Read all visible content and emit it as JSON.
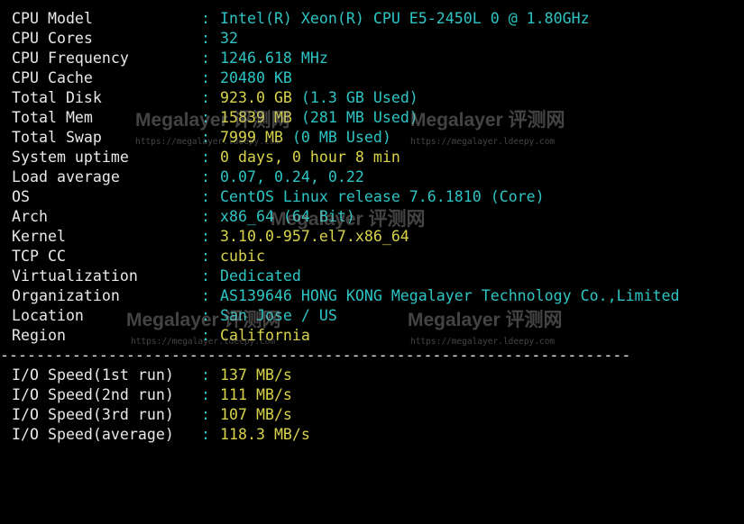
{
  "sysinfo": [
    {
      "label": "CPU Model",
      "value": "Intel(R) Xeon(R) CPU E5-2450L 0 @ 1.80GHz",
      "detail": ""
    },
    {
      "label": "CPU Cores",
      "value": "32",
      "detail": ""
    },
    {
      "label": "CPU Frequency",
      "value": "1246.618 MHz",
      "detail": ""
    },
    {
      "label": "CPU Cache",
      "value": "20480 KB",
      "detail": ""
    },
    {
      "label": "Total Disk",
      "value": "923.0 GB",
      "detail": " (1.3 GB Used)"
    },
    {
      "label": "Total Mem",
      "value": "15839 MB",
      "detail": " (281 MB Used)"
    },
    {
      "label": "Total Swap",
      "value": "7999 MB",
      "detail": " (0 MB Used)"
    },
    {
      "label": "System uptime",
      "value": "0 days, 0 hour 8 min",
      "detail": ""
    },
    {
      "label": "Load average",
      "value": "0.07, 0.24, 0.22",
      "detail": ""
    },
    {
      "label": "OS",
      "value": "CentOS Linux release 7.6.1810 (Core)",
      "detail": ""
    },
    {
      "label": "Arch",
      "value": "x86_64 (64 Bit)",
      "detail": ""
    },
    {
      "label": "Kernel",
      "value": "3.10.0-957.el7.x86_64",
      "detail": ""
    },
    {
      "label": "TCP CC",
      "value": "cubic",
      "detail": ""
    },
    {
      "label": "Virtualization",
      "value": "Dedicated",
      "detail": ""
    },
    {
      "label": "Organization",
      "value": "AS139646 HONG KONG Megalayer Technology Co.,Limited",
      "detail": ""
    },
    {
      "label": "Location",
      "value": "San Jose / US",
      "detail": ""
    },
    {
      "label": "Region",
      "value": "California",
      "detail": ""
    }
  ],
  "separator_char": ":",
  "divider": "----------------------------------------------------------------------",
  "io_speed": [
    {
      "label": "I/O Speed(1st run)",
      "value": "137 MB/s"
    },
    {
      "label": "I/O Speed(2nd run)",
      "value": "111 MB/s"
    },
    {
      "label": "I/O Speed(3rd run)",
      "value": "107 MB/s"
    },
    {
      "label": "I/O Speed(average)",
      "value": "118.3 MB/s"
    }
  ],
  "watermark": {
    "title": "Megalayer 评测网",
    "url": "https://megalayer.ldeepy.com"
  },
  "colors": {
    "background": "#000000",
    "label": "#e8e8e8",
    "cyan": "#2ec4c4",
    "yellow": "#d8d34a"
  },
  "value_colors": [
    "cyan",
    "cyan",
    "cyan",
    "cyan",
    "yellow",
    "yellow",
    "yellow",
    "yellow",
    "cyan",
    "cyan",
    "cyan",
    "yellow",
    "yellow",
    "cyan",
    "cyan",
    "cyan",
    "yellow"
  ]
}
